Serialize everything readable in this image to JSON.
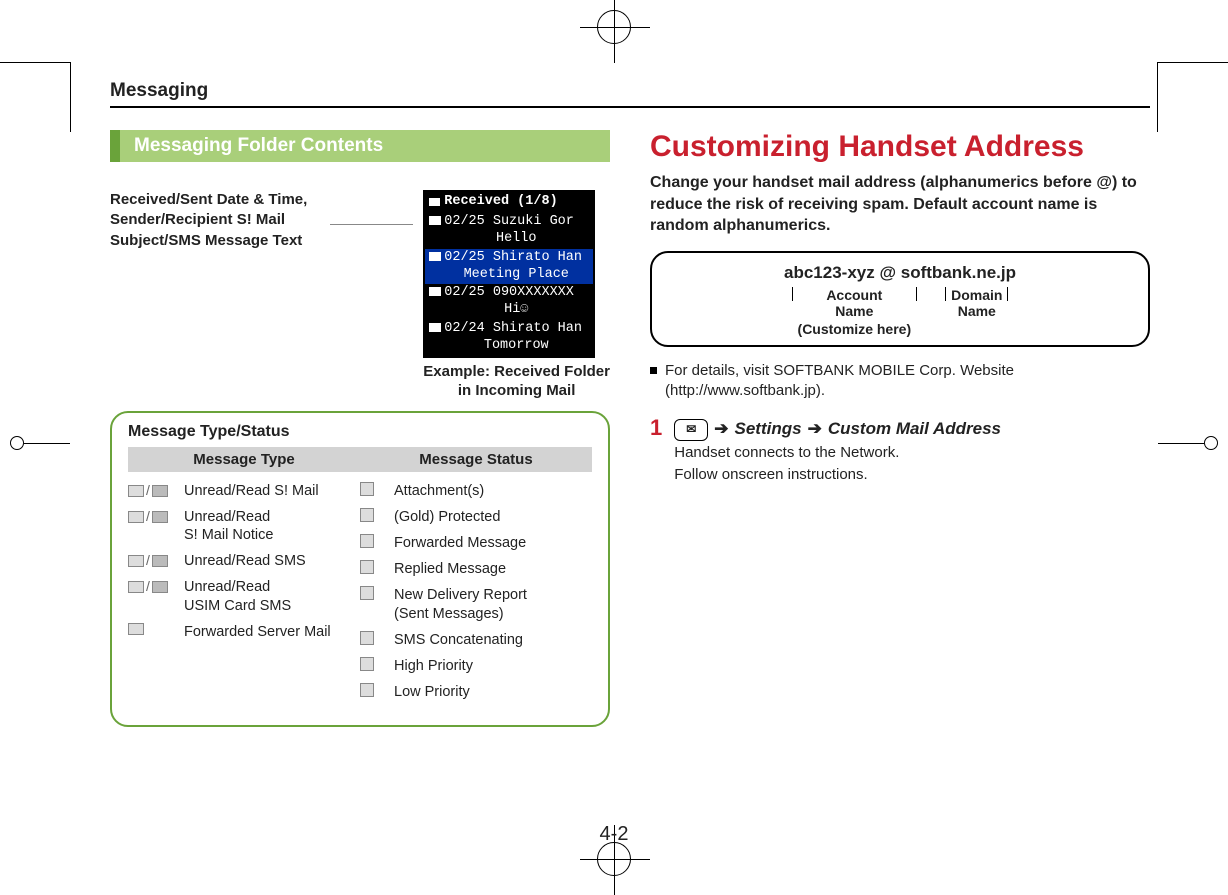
{
  "header": "Messaging",
  "left": {
    "section_title": "Messaging Folder Contents",
    "callout": "Received/Sent Date & Time, Sender/Recipient S! Mail Subject/SMS Message Text",
    "phone": {
      "title": "Received (1/8)",
      "rows": [
        {
          "line": "02/25 Suzuki Gor",
          "sub": "Hello",
          "hi": false
        },
        {
          "line": "02/25 Shirato Han",
          "sub": "Meeting Place",
          "hi": true
        },
        {
          "line": "02/25 090XXXXXXX",
          "sub": "Hi☺",
          "hi": false
        },
        {
          "line": "02/24 Shirato Han",
          "sub": "Tomorrow",
          "hi": false
        }
      ]
    },
    "phone_caption_1": "Example: Received Folder",
    "phone_caption_2": "in Incoming Mail",
    "box_title": "Message Type/Status",
    "col1_head": "Message Type",
    "col2_head": "Message Status",
    "types": [
      "Unread/Read S! Mail",
      "Unread/Read\nS! Mail Notice",
      "Unread/Read SMS",
      "Unread/Read\nUSIM Card SMS",
      "Forwarded Server Mail"
    ],
    "statuses": [
      "Attachment(s)",
      "(Gold) Protected",
      "Forwarded Message",
      "Replied Message",
      "New Delivery Report\n(Sent Messages)",
      "SMS Concatenating",
      "High Priority",
      "Low Priority"
    ]
  },
  "right": {
    "h1": "Customizing Handset Address",
    "lead": "Change your handset mail address (alphanumerics before @) to reduce the risk of receiving spam. Default account name is random alphanumerics.",
    "addr_main": "abc123-xyz @ softbank.ne.jp",
    "addr_account_l1": "Account",
    "addr_account_l2": "Name",
    "addr_account_l3": "(Customize here)",
    "addr_domain_l1": "Domain",
    "addr_domain_l2": "Name",
    "bullet": "For details, visit SOFTBANK MOBILE Corp. Website (http://www.softbank.jp).",
    "step_num": "1",
    "step_settings": "Settings",
    "step_custom": "Custom Mail Address",
    "step_arrow": "➔",
    "step_body1": "Handset connects to the Network.",
    "step_body2": "Follow onscreen instructions."
  },
  "page_num": "4-2"
}
